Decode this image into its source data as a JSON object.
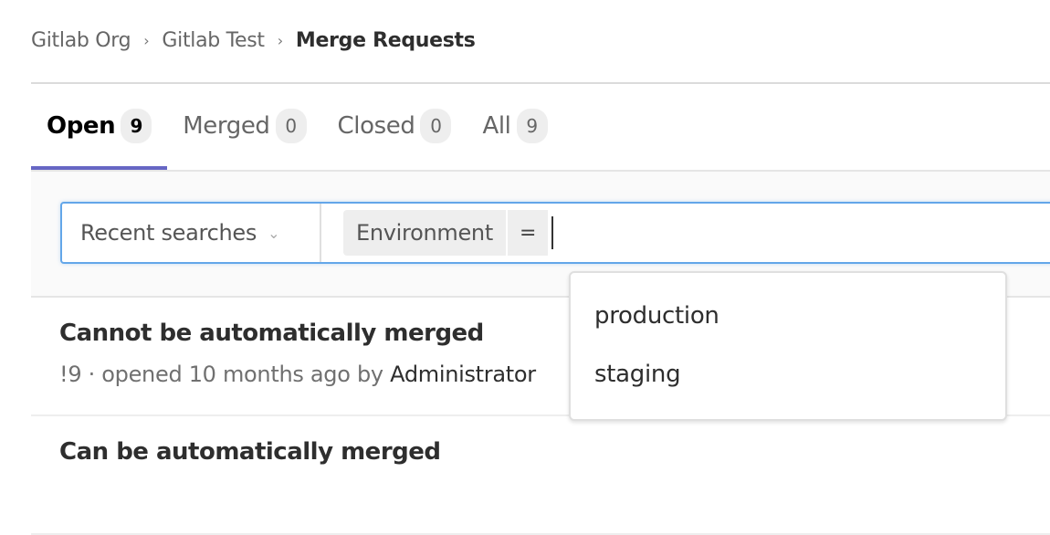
{
  "breadcrumb": {
    "items": [
      "Gitlab Org",
      "Gitlab Test"
    ],
    "current": "Merge Requests",
    "separator": "›"
  },
  "tabs": [
    {
      "label": "Open",
      "count": "9",
      "active": true
    },
    {
      "label": "Merged",
      "count": "0",
      "active": false
    },
    {
      "label": "Closed",
      "count": "0",
      "active": false
    },
    {
      "label": "All",
      "count": "9",
      "active": false
    }
  ],
  "filter": {
    "recent_searches_label": "Recent searches",
    "token_name": "Environment",
    "token_operator": "=",
    "input_value": ""
  },
  "dropdown": {
    "options": [
      "production",
      "staging"
    ]
  },
  "merge_requests": [
    {
      "title": "Cannot be automatically merged",
      "meta": "!9 · opened 10 months ago by ",
      "author": "Administrator"
    },
    {
      "title": "Can be automatically merged",
      "meta": "",
      "author": ""
    }
  ],
  "colors": {
    "active_tab_underline": "#6666c4",
    "search_focus_border": "#63a6e9"
  }
}
